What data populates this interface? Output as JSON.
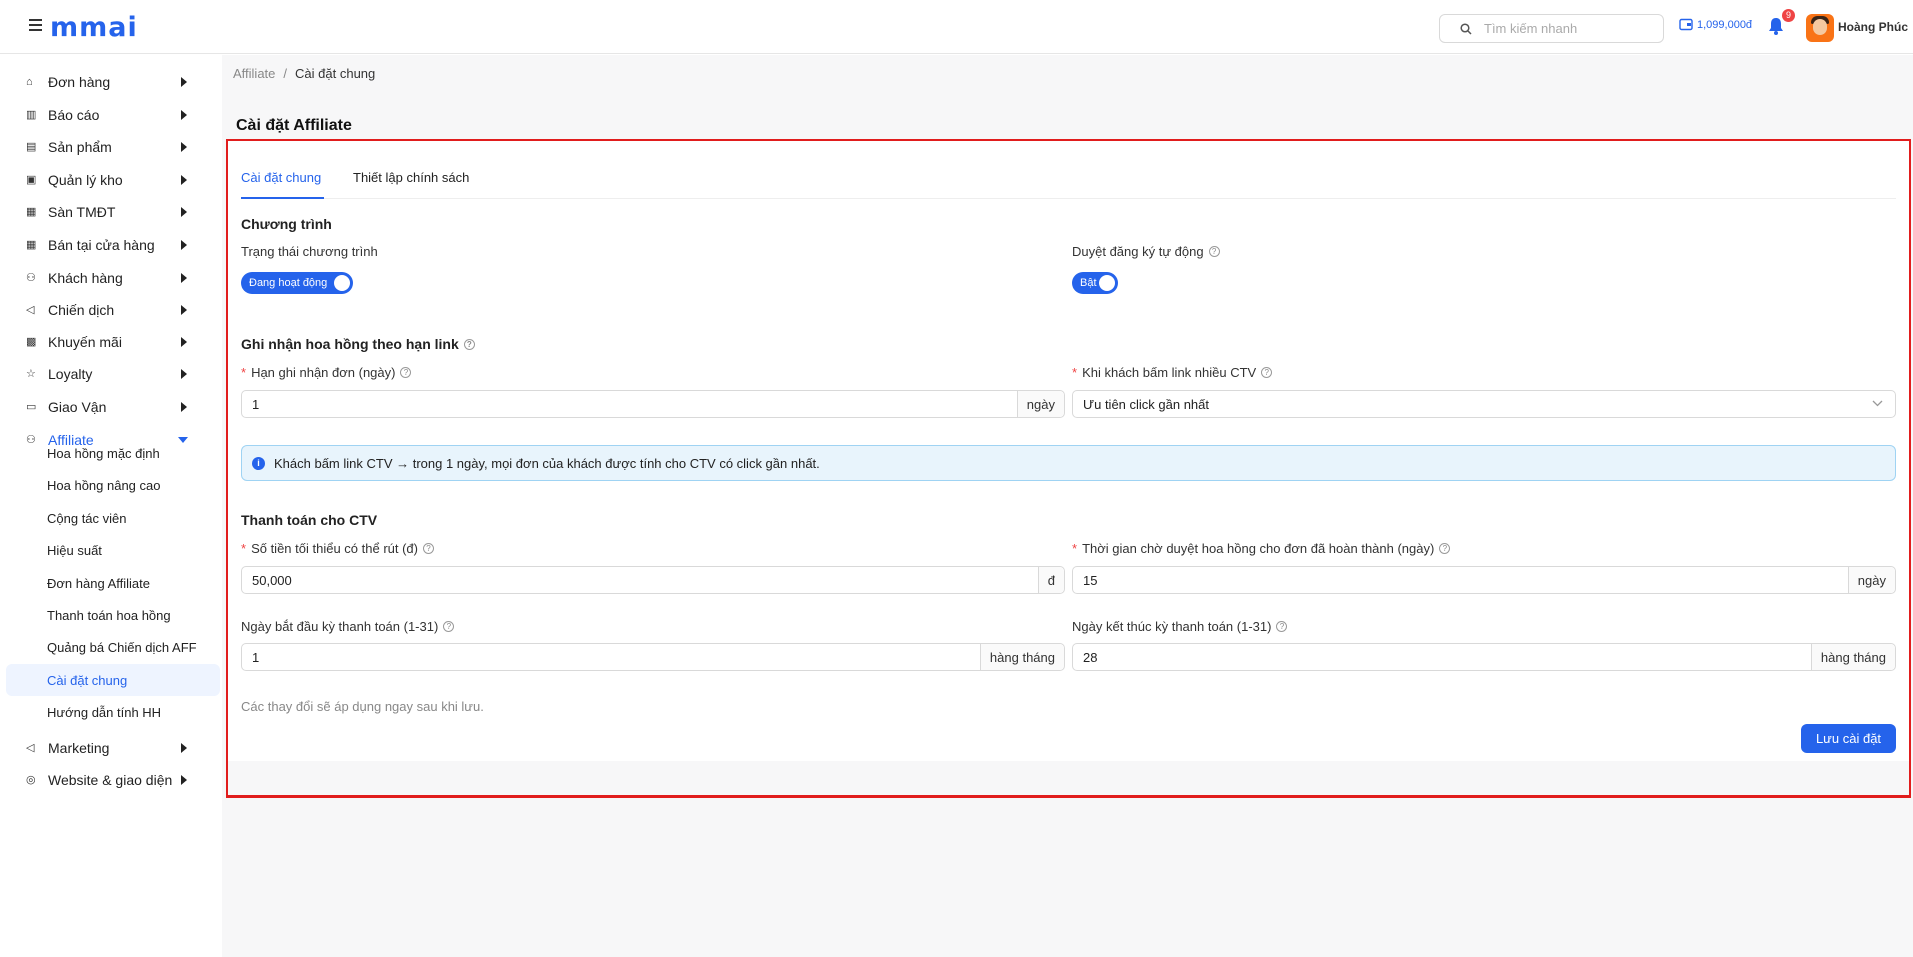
{
  "header": {
    "logo": "mmai",
    "search_placeholder": "Tìm kiếm nhanh",
    "wallet": "1,099,000đ",
    "notifications_count": "9",
    "user_name": "Hoàng Phúc"
  },
  "sidebar": {
    "items": [
      {
        "label": "Đơn hàng",
        "icon": "bag-icon"
      },
      {
        "label": "Báo cáo",
        "icon": "chart-icon"
      },
      {
        "label": "Sản phẩm",
        "icon": "box-icon"
      },
      {
        "label": "Quản lý kho",
        "icon": "warehouse-icon"
      },
      {
        "label": "Sàn TMĐT",
        "icon": "store-icon"
      },
      {
        "label": "Bán tại cửa hàng",
        "icon": "shop-icon"
      },
      {
        "label": "Khách hàng",
        "icon": "users-icon"
      },
      {
        "label": "Chiến dịch",
        "icon": "megaphone-icon"
      },
      {
        "label": "Khuyến mãi",
        "icon": "gift-icon"
      },
      {
        "label": "Loyalty",
        "icon": "star-icon"
      },
      {
        "label": "Giao Vận",
        "icon": "truck-icon"
      },
      {
        "label": "Affiliate",
        "icon": "affiliate-icon"
      }
    ],
    "affiliate_sub": [
      "Hoa hồng mặc định",
      "Hoa hồng nâng cao",
      "Cộng tác viên",
      "Hiệu suất",
      "Đơn hàng Affiliate",
      "Thanh toán hoa hồng",
      "Quảng bá Chiến dịch AFF",
      "Cài đặt chung",
      "Hướng dẫn tính HH"
    ],
    "after_items": [
      {
        "label": "Marketing",
        "icon": "marketing-icon"
      },
      {
        "label": "Website & giao diện",
        "icon": "website-icon"
      }
    ]
  },
  "breadcrumb": {
    "root": "Affiliate",
    "sep": "/",
    "current": "Cài đặt chung"
  },
  "page_title": "Cài đặt Affiliate",
  "tabs": [
    "Cài đặt chung",
    "Thiết lập chính sách"
  ],
  "program": {
    "title": "Chương trình",
    "status_label": "Trạng thái chương trình",
    "status_toggle": "Đang hoạt động",
    "auto_approve_label": "Duyệt đăng ký tự động",
    "auto_approve_toggle": "Bật"
  },
  "link_commission": {
    "title": "Ghi nhận hoa hồng theo hạn link",
    "deadline_label": "Hạn ghi nhận đơn (ngày)",
    "deadline_value": "1",
    "deadline_unit": "ngày",
    "multi_click_label": "Khi khách bấm link nhiều CTV",
    "multi_click_value": "Ưu tiên click gần nhất",
    "info": "Khách bấm link CTV → trong 1 ngày, mọi đơn của khách được tính cho CTV có click gần nhất."
  },
  "payment": {
    "title": "Thanh toán cho CTV",
    "min_amount_label": "Số tiền tối thiểu có thể rút (đ)",
    "min_amount_value": "50,000",
    "min_amount_unit": "đ",
    "wait_label": "Thời gian chờ duyệt hoa hồng cho đơn đã hoàn thành (ngày)",
    "wait_value": "15",
    "wait_unit": "ngày",
    "start_label": "Ngày bắt đầu kỳ thanh toán (1-31)",
    "start_value": "1",
    "start_unit": "hàng tháng",
    "end_label": "Ngày kết thúc kỳ thanh toán (1-31)",
    "end_value": "28",
    "end_unit": "hàng tháng"
  },
  "hint": "Các thay đổi sẽ áp dụng ngay sau khi lưu.",
  "save_label": "Lưu cài đặt",
  "colors": {
    "accent": "#2563eb",
    "highlight_border": "#e11d1d",
    "info_bg": "#e8f4fc"
  }
}
